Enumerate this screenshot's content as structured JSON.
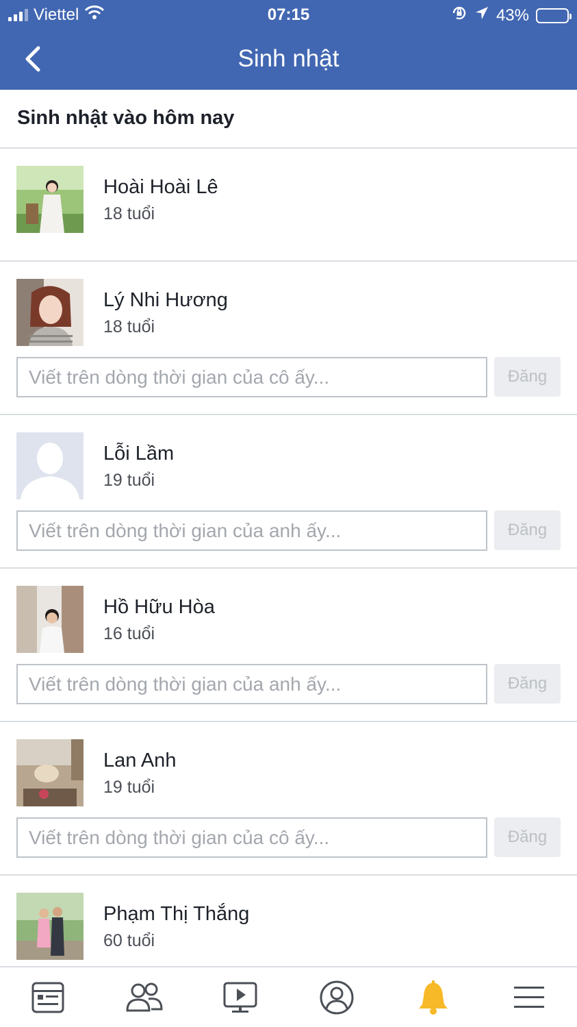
{
  "status_bar": {
    "carrier": "Viettel",
    "time": "07:15",
    "battery": "43%",
    "battery_level": 0.43,
    "icons": [
      "signal-icon",
      "wifi-icon",
      "rotation-lock-icon",
      "location-icon",
      "battery-icon"
    ]
  },
  "header": {
    "title": "Sinh nhật",
    "back_icon": "chevron-left-icon"
  },
  "section": {
    "title": "Sinh nhật vào hôm nay"
  },
  "people": [
    {
      "name": "Hoài Hoài Lê",
      "age": "18 tuổi",
      "composer": null
    },
    {
      "name": "Lý Nhi Hương",
      "age": "18 tuổi",
      "composer": {
        "placeholder": "Viết trên dòng thời gian của cô ấy...",
        "button": "Đăng"
      }
    },
    {
      "name": "Lỗi Lầm",
      "age": "19 tuổi",
      "composer": {
        "placeholder": "Viết trên dòng thời gian của anh ấy...",
        "button": "Đăng"
      }
    },
    {
      "name": "Hồ Hữu Hòa",
      "age": "16 tuổi",
      "composer": {
        "placeholder": "Viết trên dòng thời gian của anh ấy...",
        "button": "Đăng"
      }
    },
    {
      "name": "Lan Anh",
      "age": "19 tuổi",
      "composer": {
        "placeholder": "Viết trên dòng thời gian của cô ấy...",
        "button": "Đăng"
      }
    },
    {
      "name": "Phạm Thị Thắng",
      "age": "60 tuổi",
      "composer": null
    }
  ],
  "tabbar": {
    "tabs": [
      "news-feed-icon",
      "friends-icon",
      "watch-icon",
      "profile-icon",
      "notifications-bell-icon",
      "menu-icon"
    ],
    "active_tab": "notifications-bell-icon",
    "active_color": "#f7b928"
  },
  "colors": {
    "brand": "#4267b2"
  }
}
